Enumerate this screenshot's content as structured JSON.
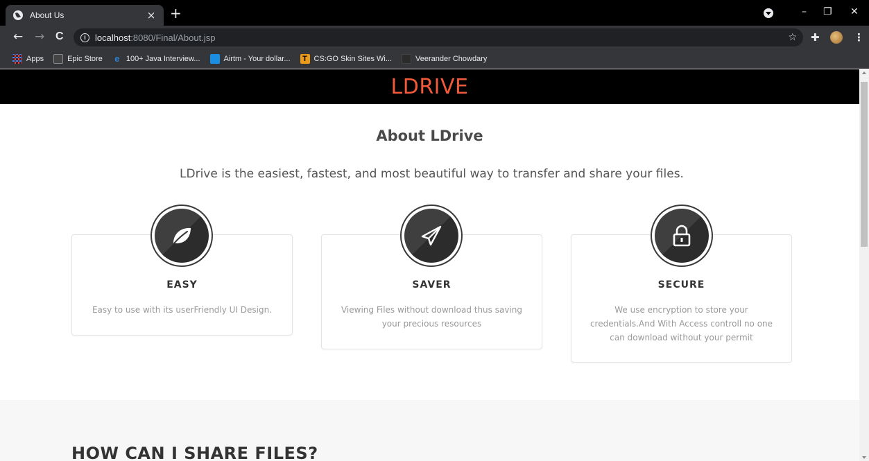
{
  "browser": {
    "tab_title": "About Us",
    "tab_close": "×",
    "new_tab": "+",
    "url_host": "localhost",
    "url_rest": ":8080/Final/About.jsp",
    "window_controls": [
      "–",
      "❐",
      "✕"
    ],
    "nav": {
      "back": "←",
      "forward": "→",
      "reload": "C"
    },
    "bookmarks": [
      {
        "label": "Apps",
        "icon": "apps-grid-icon"
      },
      {
        "label": "Epic Store",
        "icon": "epic-store-icon"
      },
      {
        "label": "100+ Java Interview...",
        "icon": "e-icon"
      },
      {
        "label": "Airtm - Your dollar...",
        "icon": "airtm-icon"
      },
      {
        "label": "CS:GO Skin Sites Wi...",
        "icon": "t-icon"
      },
      {
        "label": "Veerander Chowdary",
        "icon": "blank-page-icon"
      }
    ]
  },
  "site": {
    "brand": "LDRIVE",
    "about_title": "About LDrive",
    "about_subtitle": "LDrive is the easiest, fastest, and most beautiful way to transfer and share your files.",
    "cards": [
      {
        "title": "EASY",
        "text": "Easy to use with its userFriendly UI Design.",
        "icon": "leaf-icon"
      },
      {
        "title": "SAVER",
        "text": "Viewing Files without download thus saving your precious resources",
        "icon": "paper-plane-icon"
      },
      {
        "title": "SECURE",
        "text": "We use encryption to store your credentials.And With Access controll no one can download without your permit",
        "icon": "lock-icon"
      }
    ],
    "share_heading": "HOW CAN I SHARE FILES?"
  },
  "colors": {
    "brand": "#f05a3a",
    "header_bg": "#000000"
  }
}
